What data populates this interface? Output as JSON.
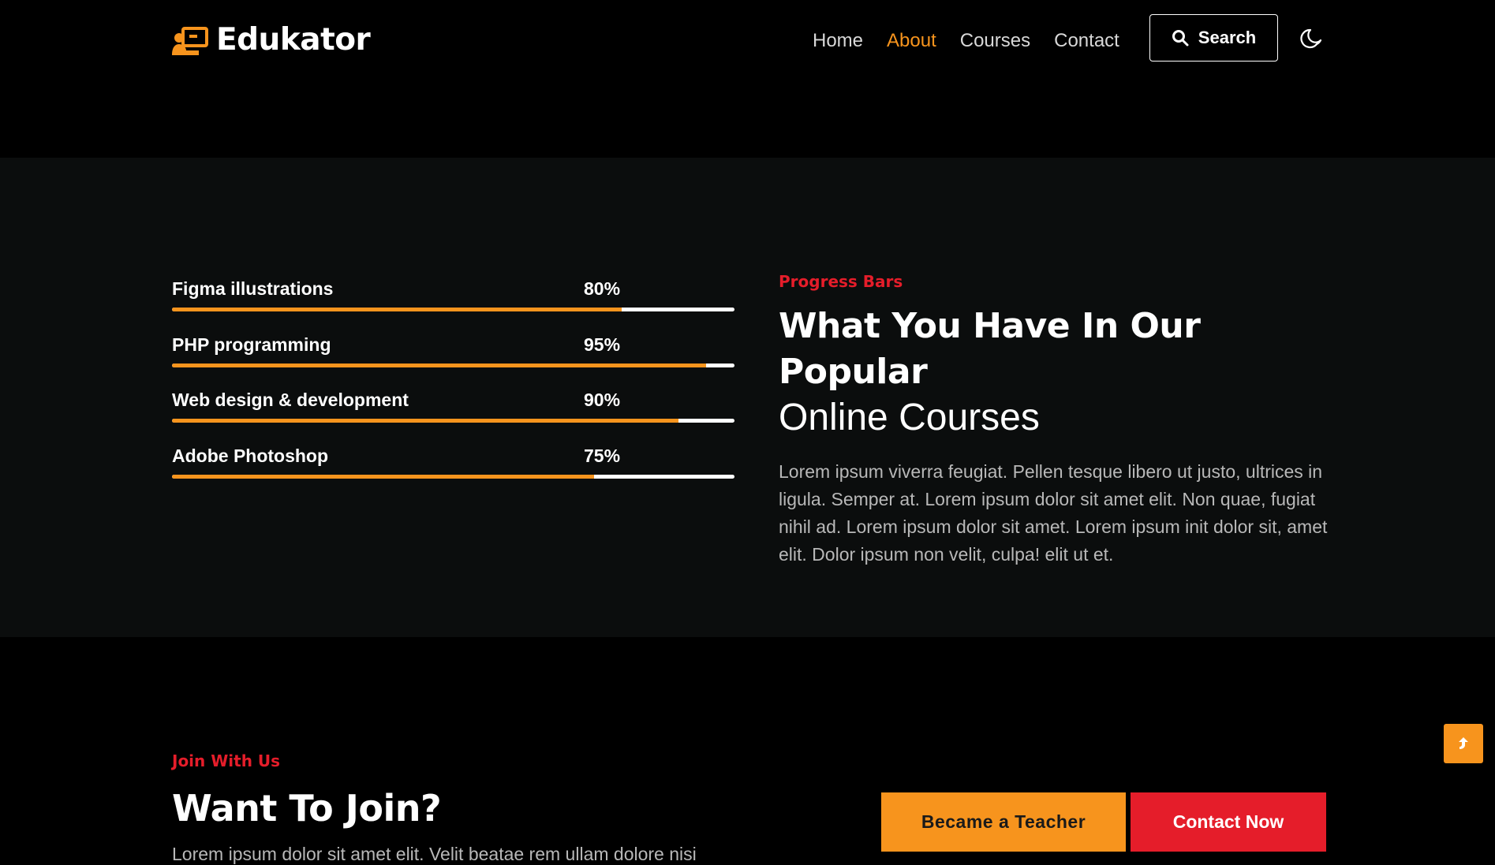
{
  "brand": {
    "name": "Edukator",
    "icon": "teacher-board-icon",
    "accent_color": "#f7941d",
    "secondary_color": "#e51d2a"
  },
  "nav": {
    "items": [
      {
        "label": "Home",
        "active": false
      },
      {
        "label": "About",
        "active": true
      },
      {
        "label": "Courses",
        "active": false
      },
      {
        "label": "Contact",
        "active": false
      }
    ],
    "search_label": "Search",
    "search_icon": "search-icon",
    "theme_icon": "moon-icon"
  },
  "progress": {
    "eyebrow": "Progress Bars",
    "title_bold": "What You Have In Our Popular",
    "title_light": "Online Courses",
    "description": "Lorem ipsum viverra feugiat. Pellen tesque libero ut justo, ultrices in ligula. Semper at. Lorem ipsum dolor sit amet elit. Non quae, fugiat nihil ad. Lorem ipsum dolor sit amet. Lorem ipsum init dolor sit, amet elit. Dolor ipsum non velit, culpa! elit ut et.",
    "bars": [
      {
        "label": "Figma illustrations",
        "percent_text": "80%",
        "value": 80
      },
      {
        "label": "PHP programming",
        "percent_text": "95%",
        "value": 95
      },
      {
        "label": "Web design & development",
        "percent_text": "90%",
        "value": 90
      },
      {
        "label": "Adobe Photoshop",
        "percent_text": "75%",
        "value": 75
      }
    ]
  },
  "join": {
    "eyebrow": "Join With Us",
    "title": "Want To Join?",
    "description": "Lorem ipsum dolor sit amet elit. Velit beatae rem ullam dolore nisi",
    "teacher_button": "Became a Teacher",
    "contact_button": "Contact Now"
  },
  "scroll_top": {
    "icon": "arrow-up-icon"
  }
}
